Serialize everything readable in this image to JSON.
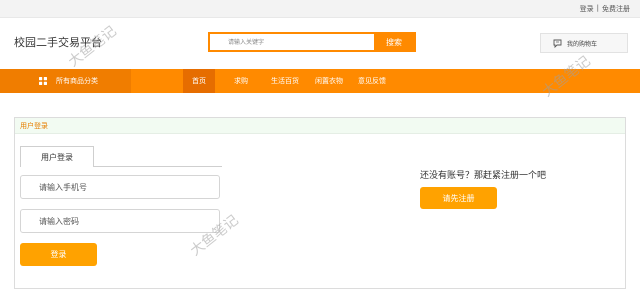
{
  "topbar": {
    "login": "登录",
    "separator": "|",
    "register": "免费注册"
  },
  "header": {
    "logo": "校园二手交易平台",
    "search": {
      "placeholder": "请输入关键字",
      "button": "搜索"
    },
    "cart": {
      "icon": "cart-icon",
      "label": "我的购物车"
    }
  },
  "nav": {
    "categories": {
      "icon": "grid-icon",
      "label": "所有商品分类"
    },
    "items": [
      {
        "label": "首页",
        "active": true
      },
      {
        "label": "求购",
        "active": false
      },
      {
        "label": "生活百货",
        "active": false
      },
      {
        "label": "闲置衣物",
        "active": false
      },
      {
        "label": "意见反馈",
        "active": false
      }
    ]
  },
  "login": {
    "section_title": "用户登录",
    "tab": "用户登录",
    "phone_placeholder": "请输入手机号",
    "password_placeholder": "请输入密码",
    "submit": "登录"
  },
  "register": {
    "prompt": "还没有账号？那赶紧注册一个吧",
    "button": "请先注册"
  },
  "watermarks": [
    "大鱼笔记",
    "大鱼笔记",
    "大鱼笔记"
  ],
  "colors": {
    "accent": "#ff8a00",
    "button": "#ffa200",
    "section_title": "#e67e00"
  }
}
